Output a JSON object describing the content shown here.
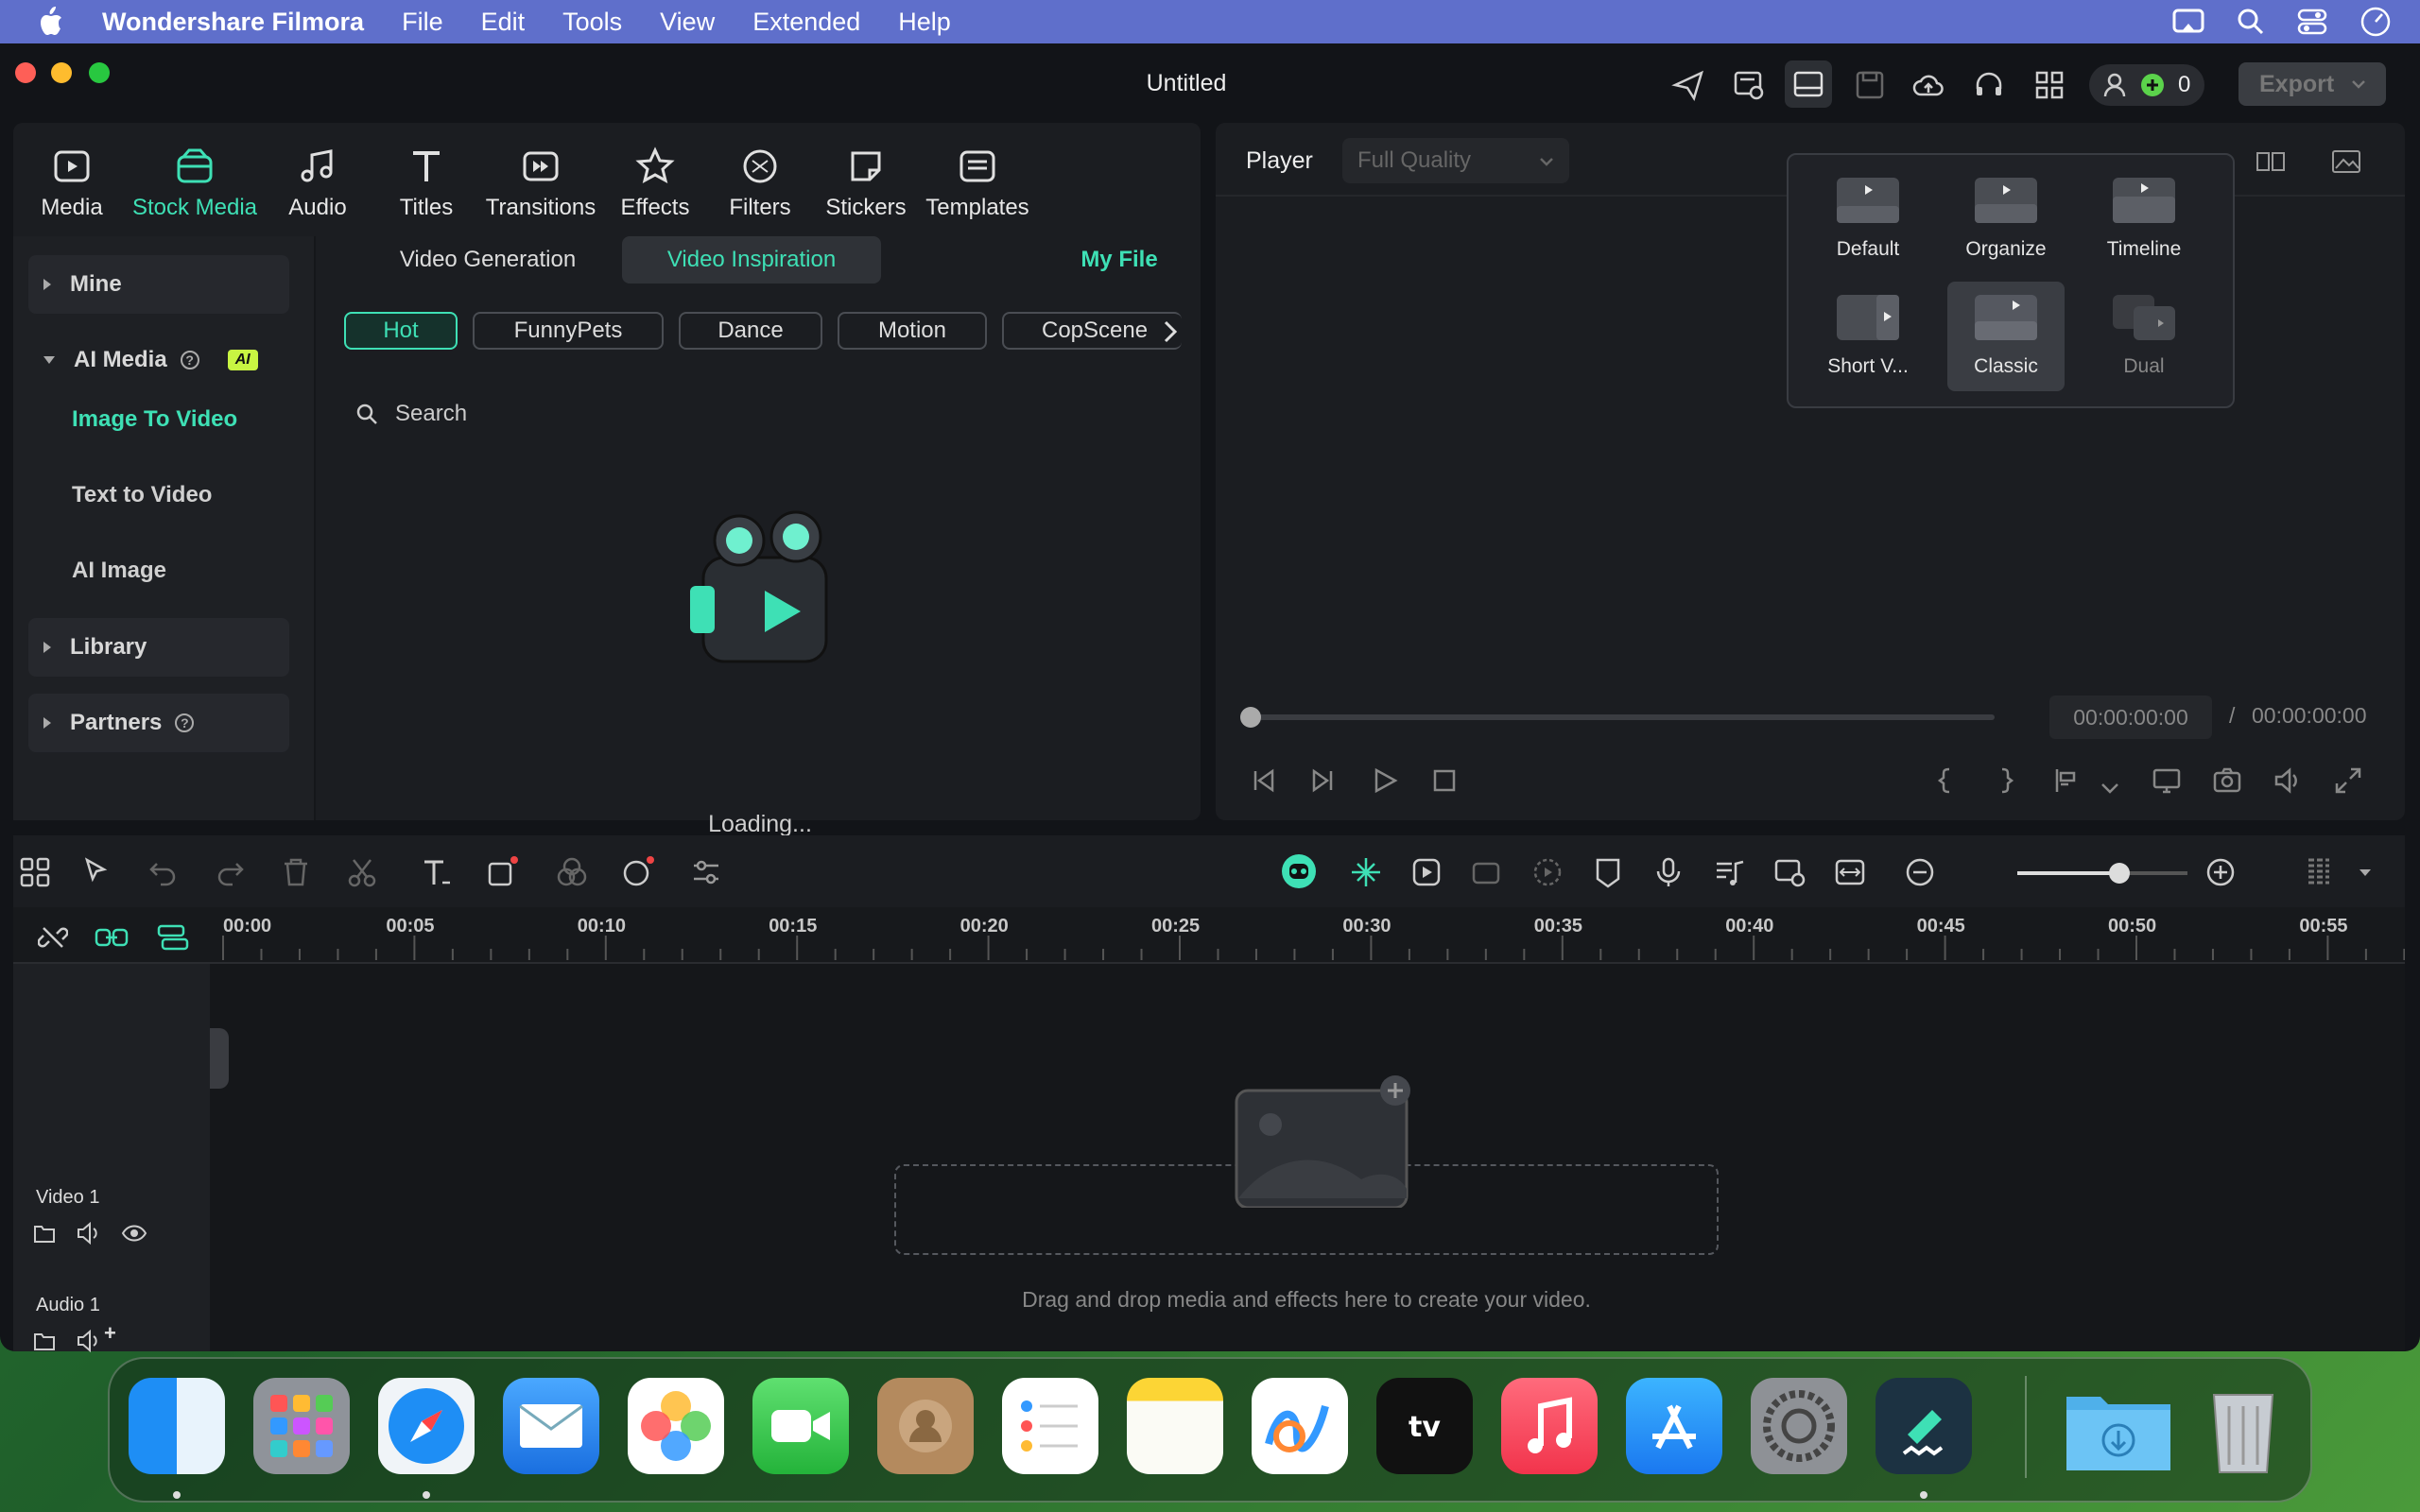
{
  "menubar": {
    "app_name": "Wondershare Filmora",
    "items": [
      "File",
      "Edit",
      "Tools",
      "View",
      "Extended",
      "Help"
    ]
  },
  "window": {
    "title": "Untitled",
    "credits": "0",
    "export_label": "Export"
  },
  "categories": [
    {
      "label": "Media",
      "icon": "media-icon"
    },
    {
      "label": "Stock Media",
      "icon": "stock-media-icon",
      "active": true
    },
    {
      "label": "Audio",
      "icon": "audio-icon"
    },
    {
      "label": "Titles",
      "icon": "titles-icon"
    },
    {
      "label": "Transitions",
      "icon": "transitions-icon"
    },
    {
      "label": "Effects",
      "icon": "effects-icon"
    },
    {
      "label": "Filters",
      "icon": "filters-icon"
    },
    {
      "label": "Stickers",
      "icon": "stickers-icon"
    },
    {
      "label": "Templates",
      "icon": "templates-icon"
    }
  ],
  "sidebar": {
    "mine": "Mine",
    "ai_media": "AI Media",
    "ai_badge": "AI",
    "image_to_video": "Image To Video",
    "text_to_video": "Text to Video",
    "ai_image": "AI Image",
    "library": "Library",
    "partners": "Partners"
  },
  "media": {
    "tab_generation": "Video Generation",
    "tab_inspiration": "Video Inspiration",
    "my_file": "My File",
    "chips": [
      "Hot",
      "FunnyPets",
      "Dance",
      "Motion",
      "CopScene"
    ],
    "search_placeholder": "Search",
    "loading": "Loading..."
  },
  "player": {
    "label": "Player",
    "quality": "Full Quality",
    "current_time": "00:00:00:00",
    "separator": "/",
    "total_time": "00:00:00:00"
  },
  "layout_popup": {
    "options": [
      "Default",
      "Organize",
      "Timeline",
      "Short V...",
      "Classic",
      "Dual"
    ],
    "selected": "Classic"
  },
  "timeline": {
    "ruler": [
      "00:00",
      "00:05",
      "00:10",
      "00:15",
      "00:20",
      "00:25",
      "00:30",
      "00:35",
      "00:40",
      "00:45",
      "00:50",
      "00:55"
    ],
    "video_track": "Video 1",
    "audio_track": "Audio 1",
    "add_track": "+",
    "drop_hint": "Drag and drop media and effects here to create your video.",
    "zoom_level": 0.6
  },
  "dock": {
    "apps": [
      "Finder",
      "Launchpad",
      "Safari",
      "Mail",
      "Photos",
      "FaceTime",
      "Contacts",
      "Reminders",
      "Notes",
      "Freeform",
      "TV",
      "Music",
      "App Store",
      "System Settings",
      "Filmora",
      "Downloads",
      "Trash"
    ]
  },
  "colors": {
    "accent": "#3ee0b5",
    "menubar": "#5f6fcb",
    "panel": "#1b1d21"
  }
}
